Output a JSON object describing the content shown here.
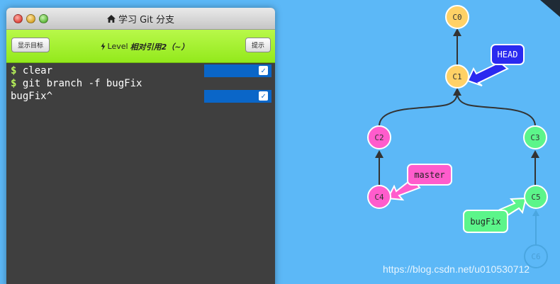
{
  "window": {
    "title": "学习 Git 分支",
    "home_icon": "home-icon"
  },
  "toolbar": {
    "show_goal_label": "显示目标",
    "hint_label": "提示",
    "level_prefix": "Level",
    "level_name": "相对引用2（~）",
    "level_icon": "lightning-icon"
  },
  "terminal": {
    "lines": [
      {
        "prompt": "$",
        "text": "clear",
        "done": true
      },
      {
        "prompt": "$",
        "text": "git branch -f bugFix",
        "done": false
      },
      {
        "prompt": "",
        "text": "bugFix^",
        "done": true
      }
    ]
  },
  "graph": {
    "colors": {
      "yellow": "#ffd166",
      "pink": "#ff5ccc",
      "green": "#5cf58a",
      "head": "#2a2af0",
      "faded": "#5cb8f7"
    },
    "commits": [
      {
        "id": "C0",
        "color": "yellow"
      },
      {
        "id": "C1",
        "color": "yellow"
      },
      {
        "id": "C2",
        "color": "pink"
      },
      {
        "id": "C3",
        "color": "green"
      },
      {
        "id": "C4",
        "color": "pink"
      },
      {
        "id": "C5",
        "color": "green"
      },
      {
        "id": "C6",
        "color": "faded"
      }
    ],
    "refs": [
      {
        "name": "HEAD",
        "target": "C1",
        "color": "head"
      },
      {
        "name": "master",
        "target": "C4",
        "color": "pink"
      },
      {
        "name": "bugFix",
        "target": "C5",
        "color": "green"
      }
    ]
  },
  "watermark": "https://blog.csdn.net/u010530712"
}
